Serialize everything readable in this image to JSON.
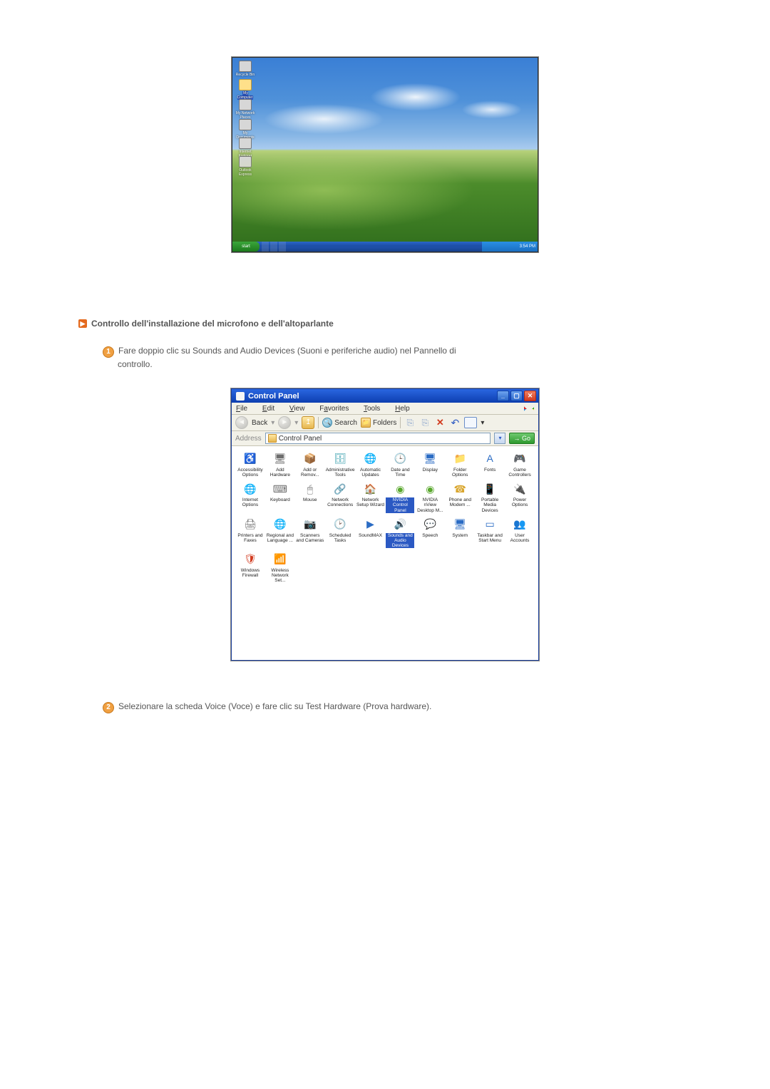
{
  "xp_desktop": {
    "icons": [
      {
        "label": "Recycle Bin"
      },
      {
        "label": "My Computer",
        "selected": true
      },
      {
        "label": "My Network Places"
      },
      {
        "label": "My Documents"
      },
      {
        "label": "Internet Explorer"
      },
      {
        "label": "Outlook Express"
      }
    ],
    "start_label": "start",
    "tray_clock": "3:54 PM"
  },
  "section": {
    "heading": "Controllo dell'installazione del microfono e dell'altoparlante",
    "step1_line1": "Fare doppio clic su Sounds and Audio Devices (Suoni e periferiche audio) nel Pannello di",
    "step1_line2": "controllo.",
    "step2": "Selezionare la scheda Voice (Voce) e fare clic su Test Hardware (Prova hardware)."
  },
  "cp": {
    "title": "Control Panel",
    "menu": {
      "file": "File",
      "edit": "Edit",
      "view": "View",
      "favorites": "Favorites",
      "tools": "Tools",
      "help": "Help"
    },
    "toolbar": {
      "back": "Back",
      "search": "Search",
      "folders": "Folders"
    },
    "address": {
      "label": "Address",
      "value": "Control Panel",
      "go": "Go"
    },
    "items": [
      [
        {
          "label": "Accessibility Options",
          "glyph": "♿",
          "cls": "ic-green"
        },
        {
          "label": "Add Hardware",
          "glyph": "🖥",
          "cls": "ic-gray"
        },
        {
          "label": "Add or Remov...",
          "glyph": "📦",
          "cls": "ic-yellow"
        },
        {
          "label": "Administrative Tools",
          "glyph": "🗄",
          "cls": "ic-teal"
        },
        {
          "label": "Automatic Updates",
          "glyph": "🌐",
          "cls": "ic-yellow"
        },
        {
          "label": "Date and Time",
          "glyph": "🕒",
          "cls": "ic-blue"
        },
        {
          "label": "Display",
          "glyph": "🖥",
          "cls": "ic-blue"
        },
        {
          "label": "Folder Options",
          "glyph": "📁",
          "cls": "ic-yellow"
        },
        {
          "label": "Fonts",
          "glyph": "A",
          "cls": "ic-blue"
        },
        {
          "label": "Game Controllers",
          "glyph": "🎮",
          "cls": "ic-gray"
        }
      ],
      [
        {
          "label": "Internet Options",
          "glyph": "🌐",
          "cls": "ic-blue"
        },
        {
          "label": "Keyboard",
          "glyph": "⌨",
          "cls": "ic-gray"
        },
        {
          "label": "Mouse",
          "glyph": "🖱",
          "cls": "ic-gray"
        },
        {
          "label": "Network Connections",
          "glyph": "🔗",
          "cls": "ic-blue"
        },
        {
          "label": "Network Setup Wizard",
          "glyph": "🏠",
          "cls": "ic-orange"
        },
        {
          "label": "NVIDIA Control Panel",
          "glyph": "◉",
          "cls": "ic-nv",
          "selected": true
        },
        {
          "label": "NVIDIA nView Desktop M...",
          "glyph": "◉",
          "cls": "ic-nv"
        },
        {
          "label": "Phone and Modem ...",
          "glyph": "☎",
          "cls": "ic-yellow"
        },
        {
          "label": "Portable Media Devices",
          "glyph": "📱",
          "cls": "ic-teal"
        },
        {
          "label": "Power Options",
          "glyph": "🔌",
          "cls": "ic-green"
        }
      ],
      [
        {
          "label": "Printers and Faxes",
          "glyph": "🖨",
          "cls": "ic-gray"
        },
        {
          "label": "Regional and Language ...",
          "glyph": "🌐",
          "cls": "ic-blue"
        },
        {
          "label": "Scanners and Cameras",
          "glyph": "📷",
          "cls": "ic-gray"
        },
        {
          "label": "Scheduled Tasks",
          "glyph": "🕑",
          "cls": "ic-yellow"
        },
        {
          "label": "SoundMAX",
          "glyph": "▶",
          "cls": "ic-blue"
        },
        {
          "label": "Sounds and Audio Devices",
          "glyph": "🔊",
          "cls": "ic-gray",
          "selected": true
        },
        {
          "label": "Speech",
          "glyph": "💬",
          "cls": "ic-yellow"
        },
        {
          "label": "System",
          "glyph": "🖥",
          "cls": "ic-blue"
        },
        {
          "label": "Taskbar and Start Menu",
          "glyph": "▭",
          "cls": "ic-blue"
        },
        {
          "label": "User Accounts",
          "glyph": "👥",
          "cls": "ic-orange"
        }
      ],
      [
        {
          "label": "Windows Firewall",
          "glyph": "🛡",
          "cls": "ic-red"
        },
        {
          "label": "Wireless Network Set...",
          "glyph": "📶",
          "cls": "ic-green"
        }
      ]
    ]
  }
}
